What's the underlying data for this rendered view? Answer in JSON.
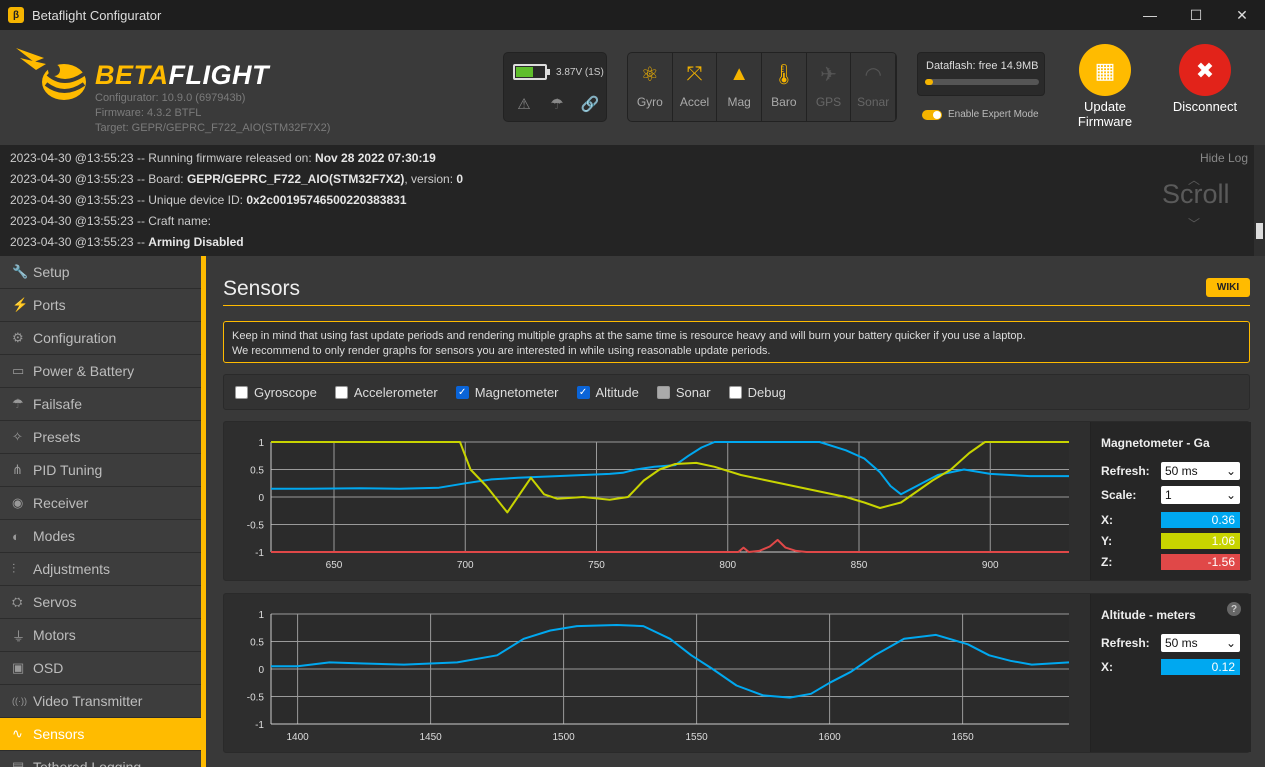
{
  "window": {
    "title": "Betaflight Configurator",
    "controls": [
      "—",
      "☐",
      "✕"
    ]
  },
  "header": {
    "brand_a": "BETA",
    "brand_b": "FLIGHT",
    "configurator_version": "Configurator: 10.9.0 (697943b)",
    "firmware_version": "Firmware: 4.3.2 BTFL",
    "target": "Target: GEPR/GEPRC_F722_AIO(STM32F7X2)",
    "battery_text": "3.87V (1S)",
    "battery_level": 0.55,
    "sensors": [
      {
        "label": "Gyro",
        "icon": "gyro-icon",
        "active": true
      },
      {
        "label": "Accel",
        "icon": "accel-icon",
        "active": true
      },
      {
        "label": "Mag",
        "icon": "mag-icon",
        "active": true
      },
      {
        "label": "Baro",
        "icon": "baro-icon",
        "active": true
      },
      {
        "label": "GPS",
        "icon": "gps-icon",
        "active": false
      },
      {
        "label": "Sonar",
        "icon": "sonar-icon",
        "active": false
      }
    ],
    "dataflash_text": "Dataflash: free 14.9MB",
    "dataflash_used": 0.07,
    "expert_mode_label": "Enable Expert Mode",
    "update_firmware_line1": "Update",
    "update_firmware_line2": "Firmware",
    "disconnect_label": "Disconnect",
    "colors": {
      "accent": "#ffbb00",
      "disconnect": "#e2231a"
    }
  },
  "log": {
    "hide_label": "Hide Log",
    "scroll_label": "Scroll",
    "lines": [
      {
        "prefix": "2023-04-30 @13:55:23 -- Running firmware released on: ",
        "bold": "Nov 28 2022 07:30:19",
        "suffix": ""
      },
      {
        "prefix": "2023-04-30 @13:55:23 -- Board: ",
        "bold": "GEPR/GEPRC_F722_AIO(STM32F7X2)",
        "suffix": ", version: ",
        "bold2": "0"
      },
      {
        "prefix": "2023-04-30 @13:55:23 -- Unique device ID: ",
        "bold": "0x2c00195746500220383831",
        "suffix": ""
      },
      {
        "prefix": "2023-04-30 @13:55:23 -- Craft name: ",
        "bold": "",
        "suffix": ""
      },
      {
        "prefix": "2023-04-30 @13:55:23 -- ",
        "bold": "Arming Disabled",
        "suffix": ""
      }
    ]
  },
  "nav": [
    {
      "label": "Setup",
      "icon": "wrench-icon",
      "glyph": "🔧"
    },
    {
      "label": "Ports",
      "icon": "plug-icon",
      "glyph": "⚡"
    },
    {
      "label": "Configuration",
      "icon": "gear-icon",
      "glyph": "⚙"
    },
    {
      "label": "Power & Battery",
      "icon": "battery-icon",
      "glyph": "▭"
    },
    {
      "label": "Failsafe",
      "icon": "parachute-icon",
      "glyph": "☂"
    },
    {
      "label": "Presets",
      "icon": "wand-icon",
      "glyph": "✧"
    },
    {
      "label": "PID Tuning",
      "icon": "pid-icon",
      "glyph": "⋔"
    },
    {
      "label": "Receiver",
      "icon": "receiver-icon",
      "glyph": "◉"
    },
    {
      "label": "Modes",
      "icon": "toggles-icon",
      "glyph": "◐"
    },
    {
      "label": "Adjustments",
      "icon": "sliders-icon",
      "glyph": "⫶"
    },
    {
      "label": "Servos",
      "icon": "servo-icon",
      "glyph": "⛭"
    },
    {
      "label": "Motors",
      "icon": "motor-icon",
      "glyph": "⏚"
    },
    {
      "label": "OSD",
      "icon": "osd-icon",
      "glyph": "▣"
    },
    {
      "label": "Video Transmitter",
      "icon": "antenna-icon",
      "glyph": "((·))"
    },
    {
      "label": "Sensors",
      "icon": "pulse-icon",
      "glyph": "∿",
      "active": true
    },
    {
      "label": "Tethered Logging",
      "icon": "log-icon",
      "glyph": "▤"
    }
  ],
  "main": {
    "title": "Sensors",
    "wiki_label": "WIKI",
    "note_line1": "Keep in mind that using fast update periods and rendering multiple graphs at the same time is resource heavy and will burn your battery quicker if you use a laptop.",
    "note_line2": "We recommend to only render graphs for sensors you are interested in while using reasonable update periods.",
    "checkboxes": [
      {
        "label": "Gyroscope",
        "checked": false,
        "disabled": false
      },
      {
        "label": "Accelerometer",
        "checked": false,
        "disabled": false
      },
      {
        "label": "Magnetometer",
        "checked": true,
        "disabled": false
      },
      {
        "label": "Altitude",
        "checked": true,
        "disabled": false
      },
      {
        "label": "Sonar",
        "checked": false,
        "disabled": true
      },
      {
        "label": "Debug",
        "checked": false,
        "disabled": false
      }
    ],
    "mag_panel": {
      "title": "Magnetometer - Ga",
      "refresh_label": "Refresh:",
      "refresh_value": "50 ms",
      "scale_label": "Scale:",
      "scale_value": "1",
      "x_label": "X:",
      "x_value": "0.36",
      "y_label": "Y:",
      "y_value": "1.06",
      "z_label": "Z:",
      "z_value": "-1.56",
      "x_color": "#00a8f0",
      "y_color": "#c8d400",
      "z_color": "#e04848"
    },
    "alt_panel": {
      "title": "Altitude - meters",
      "refresh_label": "Refresh:",
      "refresh_value": "50 ms",
      "x_label": "X:",
      "x_value": "0.12"
    }
  },
  "chart_data": [
    {
      "type": "line",
      "xlim": [
        626,
        930
      ],
      "ylim": [
        -1,
        1
      ],
      "x_ticks": [
        650,
        700,
        750,
        800,
        850,
        900
      ],
      "y_ticks": [
        1,
        0.5,
        0,
        -0.5,
        -1
      ],
      "grid": true,
      "series": [
        {
          "name": "X",
          "color": "#00a8f0",
          "points": [
            [
              626,
              0.15
            ],
            [
              640,
              0.15
            ],
            [
              660,
              0.16
            ],
            [
              675,
              0.15
            ],
            [
              690,
              0.17
            ],
            [
              700,
              0.25
            ],
            [
              710,
              0.32
            ],
            [
              720,
              0.35
            ],
            [
              735,
              0.38
            ],
            [
              745,
              0.4
            ],
            [
              755,
              0.42
            ],
            [
              760,
              0.44
            ],
            [
              765,
              0.5
            ],
            [
              772,
              0.55
            ],
            [
              780,
              0.58
            ],
            [
              785,
              0.75
            ],
            [
              790,
              0.9
            ],
            [
              795,
              1.0
            ],
            [
              810,
              1.0
            ],
            [
              825,
              1.0
            ],
            [
              835,
              1.0
            ],
            [
              845,
              0.85
            ],
            [
              852,
              0.7
            ],
            [
              858,
              0.45
            ],
            [
              862,
              0.2
            ],
            [
              866,
              0.05
            ],
            [
              872,
              0.2
            ],
            [
              880,
              0.4
            ],
            [
              890,
              0.5
            ],
            [
              900,
              0.42
            ],
            [
              915,
              0.38
            ],
            [
              930,
              0.38
            ]
          ]
        },
        {
          "name": "Y",
          "color": "#c8d400",
          "points": [
            [
              626,
              1.0
            ],
            [
              650,
              1.0
            ],
            [
              680,
              1.0
            ],
            [
              698,
              1.0
            ],
            [
              702,
              0.5
            ],
            [
              708,
              0.2
            ],
            [
              713,
              -0.1
            ],
            [
              716,
              -0.28
            ],
            [
              720,
              0.0
            ],
            [
              725,
              0.35
            ],
            [
              730,
              0.05
            ],
            [
              735,
              -0.03
            ],
            [
              745,
              0.0
            ],
            [
              755,
              -0.05
            ],
            [
              762,
              0.0
            ],
            [
              768,
              0.3
            ],
            [
              774,
              0.5
            ],
            [
              780,
              0.6
            ],
            [
              788,
              0.62
            ],
            [
              795,
              0.55
            ],
            [
              805,
              0.4
            ],
            [
              815,
              0.3
            ],
            [
              825,
              0.2
            ],
            [
              835,
              0.1
            ],
            [
              845,
              0.0
            ],
            [
              852,
              -0.1
            ],
            [
              858,
              -0.2
            ],
            [
              866,
              -0.1
            ],
            [
              872,
              0.1
            ],
            [
              878,
              0.3
            ],
            [
              885,
              0.5
            ],
            [
              892,
              0.8
            ],
            [
              898,
              1.0
            ],
            [
              915,
              1.0
            ],
            [
              930,
              1.0
            ]
          ]
        },
        {
          "name": "Z",
          "color": "#e04848",
          "points": [
            [
              626,
              -1.0
            ],
            [
              804,
              -1.0
            ],
            [
              806,
              -0.92
            ],
            [
              808,
              -1.0
            ],
            [
              812,
              -0.98
            ],
            [
              816,
              -0.9
            ],
            [
              819,
              -0.78
            ],
            [
              822,
              -0.92
            ],
            [
              826,
              -0.98
            ],
            [
              830,
              -1.0
            ],
            [
              930,
              -1.0
            ]
          ]
        }
      ]
    },
    {
      "type": "line",
      "xlim": [
        1390,
        1690
      ],
      "ylim": [
        -1,
        1
      ],
      "x_ticks": [
        1400,
        1450,
        1500,
        1550,
        1600,
        1650
      ],
      "y_ticks": [
        1,
        0.5,
        0,
        -0.5,
        -1
      ],
      "grid": true,
      "series": [
        {
          "name": "X",
          "color": "#00a8f0",
          "points": [
            [
              1390,
              0.05
            ],
            [
              1400,
              0.05
            ],
            [
              1412,
              0.12
            ],
            [
              1425,
              0.1
            ],
            [
              1440,
              0.08
            ],
            [
              1460,
              0.12
            ],
            [
              1475,
              0.25
            ],
            [
              1485,
              0.55
            ],
            [
              1495,
              0.7
            ],
            [
              1505,
              0.78
            ],
            [
              1520,
              0.8
            ],
            [
              1530,
              0.78
            ],
            [
              1540,
              0.55
            ],
            [
              1548,
              0.25
            ],
            [
              1556,
              0.0
            ],
            [
              1565,
              -0.3
            ],
            [
              1575,
              -0.48
            ],
            [
              1585,
              -0.52
            ],
            [
              1593,
              -0.45
            ],
            [
              1600,
              -0.25
            ],
            [
              1608,
              -0.05
            ],
            [
              1617,
              0.25
            ],
            [
              1628,
              0.55
            ],
            [
              1640,
              0.62
            ],
            [
              1652,
              0.45
            ],
            [
              1660,
              0.25
            ],
            [
              1668,
              0.15
            ],
            [
              1676,
              0.08
            ],
            [
              1683,
              0.1
            ],
            [
              1690,
              0.12
            ]
          ]
        }
      ]
    }
  ]
}
